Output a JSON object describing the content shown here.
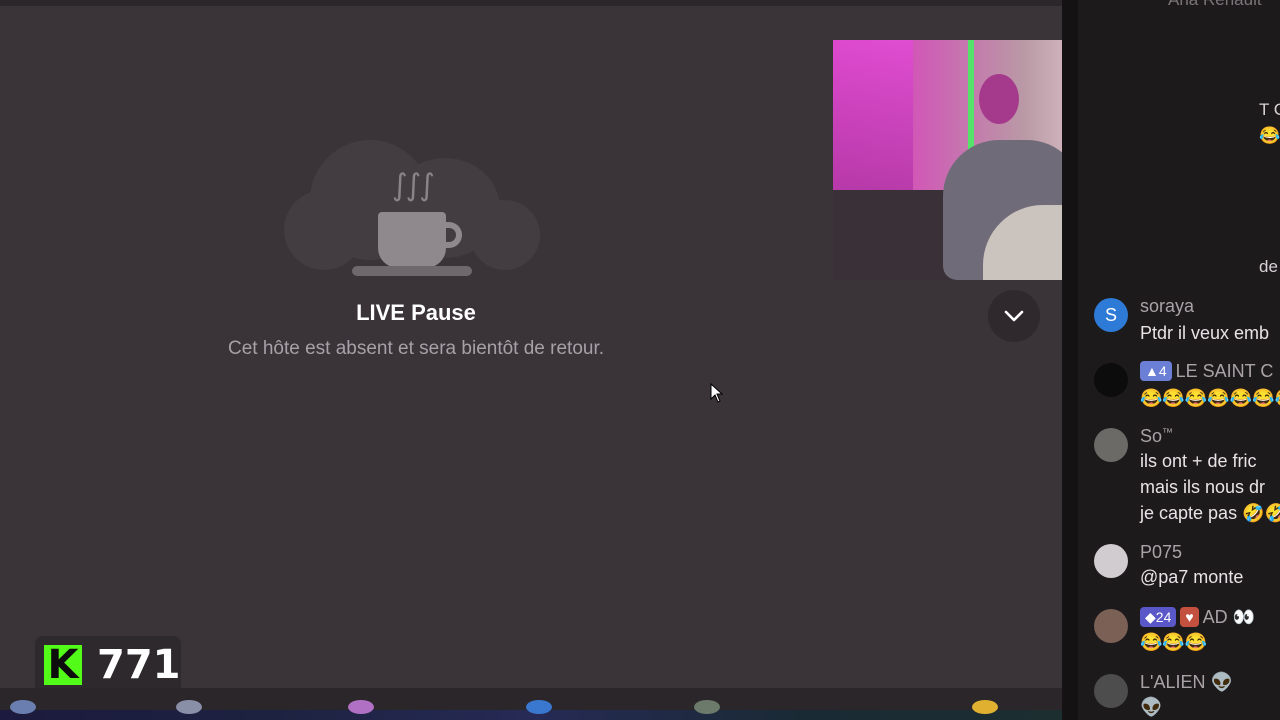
{
  "pause": {
    "title": "LIVE Pause",
    "subtitle": "Cet hôte est absent et sera bientôt de retour."
  },
  "viewer_counter": {
    "logo": "K",
    "count": "771",
    "logo_color": "#53fc18"
  },
  "chat": {
    "top_partial_name": "Ana Renault",
    "side_fragments": [
      "T C",
      "😂",
      "de"
    ],
    "messages": [
      {
        "username": "soraya",
        "avatar_letter": "S",
        "avatar_color": "#2d7bd6",
        "text": [
          "Ptdr il veux emb"
        ]
      },
      {
        "username": "LE SAINT C",
        "badge": "4",
        "badge_icon": "▲",
        "badge_color": "#6b7fd6",
        "avatar_color": "#0c0c0c",
        "text": [
          "😂😂😂😂😂😂😂"
        ]
      },
      {
        "username": "So",
        "tm": "™",
        "avatar_color": "#6c6a66",
        "text": [
          "ils ont + de fric",
          "mais ils nous dr",
          "je capte pas 🤣🤣"
        ]
      },
      {
        "username": "P075",
        "avatar_color": "#d0cccf",
        "text": [
          "@pa7 monte"
        ]
      },
      {
        "username": "AD 👀",
        "badge": "24",
        "badge_icon": "◆",
        "badge_color": "#5a58c8",
        "badge2_icon": "♥",
        "badge2_color": "#c4513f",
        "avatar_color": "#7a6055",
        "text": [
          "😂😂😂"
        ]
      },
      {
        "username": "L'ALIEN 👽",
        "avatar_color": "#4d4d4d",
        "text": [
          "👽"
        ]
      }
    ]
  },
  "controls": {
    "collapse_icon": "chevron-down-icon"
  },
  "colors": {
    "background": "#3a3338",
    "chat_background": "#1d1a1c"
  }
}
